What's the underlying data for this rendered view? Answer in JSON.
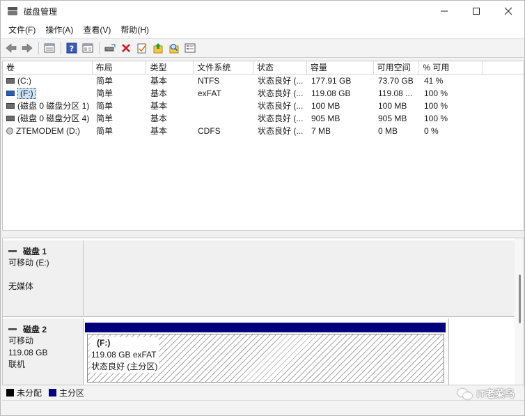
{
  "window": {
    "title": "磁盘管理",
    "controls": [
      "—",
      "☐",
      "✕"
    ]
  },
  "menu": [
    "文件(F)",
    "操作(A)",
    "查看(V)",
    "帮助(H)"
  ],
  "toolbar": {
    "icons": [
      "back-arrow-icon",
      "forward-arrow-icon",
      "volume-view-icon",
      "help-icon",
      "properties-icon",
      "connect-icon",
      "delete-icon",
      "check-icon",
      "format-icon",
      "search-icon",
      "settings-icon"
    ]
  },
  "volume_list": {
    "columns": [
      "卷",
      "布局",
      "类型",
      "文件系统",
      "状态",
      "容量",
      "可用空间",
      "% 可用"
    ],
    "rows": [
      {
        "name": "(C:)",
        "icon": "hdd",
        "layout": "简单",
        "type": "基本",
        "fs": "NTFS",
        "status": "状态良好 (...",
        "capacity": "177.91 GB",
        "free": "73.70 GB",
        "pct": "41 %"
      },
      {
        "name": "(F:)",
        "icon": "usb",
        "layout": "简单",
        "type": "基本",
        "fs": "exFAT",
        "status": "状态良好 (...",
        "capacity": "119.08 GB",
        "free": "119.08 ...",
        "pct": "100 %"
      },
      {
        "name": "(磁盘 0 磁盘分区 1)",
        "icon": "hdd",
        "layout": "简单",
        "type": "基本",
        "fs": "",
        "status": "状态良好 (...",
        "capacity": "100 MB",
        "free": "100 MB",
        "pct": "100 %"
      },
      {
        "name": "(磁盘 0 磁盘分区 4)",
        "icon": "hdd",
        "layout": "简单",
        "type": "基本",
        "fs": "",
        "status": "状态良好 (...",
        "capacity": "905 MB",
        "free": "905 MB",
        "pct": "100 %"
      },
      {
        "name": "ZTEMODEM (D:)",
        "icon": "cd",
        "layout": "简单",
        "type": "基本",
        "fs": "CDFS",
        "status": "状态良好 (...",
        "capacity": "7 MB",
        "free": "0 MB",
        "pct": "0 %"
      }
    ]
  },
  "disks": [
    {
      "name": "磁盘 1",
      "lines": [
        "可移动 (E:)",
        "",
        "无媒体"
      ]
    },
    {
      "name": "磁盘 2",
      "lines": [
        "可移动",
        "119.08 GB",
        "联机"
      ],
      "partition": {
        "name": "(F:)",
        "size": "119.08 GB exFAT",
        "status": "状态良好 (主分区)"
      }
    }
  ],
  "legend": [
    {
      "label": "未分配",
      "color": "#000000"
    },
    {
      "label": "主分区",
      "color": "#00007e"
    }
  ],
  "watermark": "IT老菜鸟"
}
